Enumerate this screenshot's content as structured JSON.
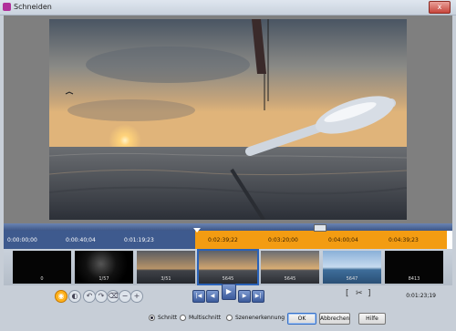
{
  "window": {
    "title": "Schneiden",
    "close_label": "x"
  },
  "timeline": {
    "ticks_left": [
      "0:00:00;00",
      "0:00:40;04",
      "0:01:19;23"
    ],
    "ticks_right": [
      "0:02:39;22",
      "0:03:20;00",
      "0:04:00;04",
      "0:04:39;23"
    ]
  },
  "thumbnails": [
    {
      "label": "0"
    },
    {
      "label": "1/57"
    },
    {
      "label": "3/51"
    },
    {
      "label": "5645"
    },
    {
      "label": "5645"
    },
    {
      "label": "5647"
    },
    {
      "label": "8413"
    }
  ],
  "controls": {
    "timecode": "0:01:23;19"
  },
  "modes": {
    "schnitt": "Schnitt",
    "multischnitt": "Multischnitt",
    "szenen": "Szenenerkennung",
    "selected": "Schnitt"
  },
  "buttons": {
    "ok": "OK",
    "cancel": "Abbrechen",
    "help": "Hilfe"
  },
  "colors": {
    "accent_orange": "#f39c12",
    "timeline_blue": "#3e5a8e",
    "selection_blue": "#2a62b8"
  }
}
